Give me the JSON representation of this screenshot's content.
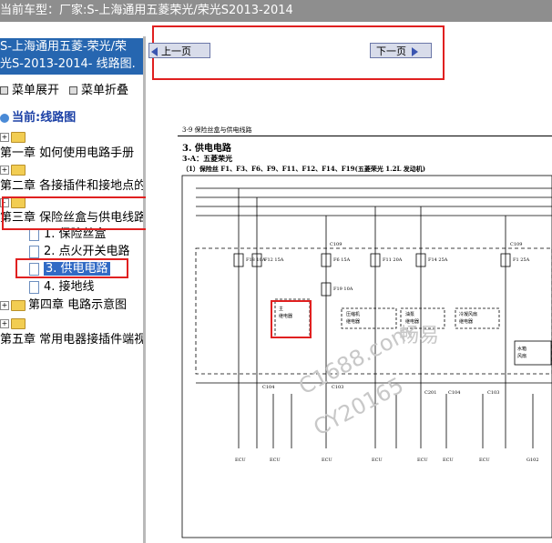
{
  "titlebar": {
    "label": "当前车型：",
    "model": "厂家:S-上海通用五菱荣光/荣光S2013-2014"
  },
  "sidebar": {
    "header_line1": "S-上海通用五菱-荣光/荣",
    "header_line2": "光S-2013-2014- 线路图.",
    "expand_label": "菜单展开",
    "collapse_label": "菜单折叠",
    "current_label": "当前:线路图",
    "tree": [
      {
        "label": "第一章 如何使用电路手册"
      },
      {
        "label": "第二章 各接插件和接地点的"
      },
      {
        "label": "第三章 保险丝盒与供电线路"
      },
      {
        "label": "1. 保险丝盒"
      },
      {
        "label": "2. 点火开关电路"
      },
      {
        "label": "3. 供电电路"
      },
      {
        "label": "4. 接地线"
      },
      {
        "label": "第四章 电路示意图"
      },
      {
        "label": "第五章 常用电器接插件端视"
      }
    ]
  },
  "nav": {
    "prev_label": "上一页",
    "next_label": "下一页"
  },
  "document": {
    "page_header": "3-9  保险丝盒与供电线路",
    "section_title": "3. 供电电路",
    "subsection": "3-A：五菱荣光",
    "subtitle": "（1）保险丝 F1、F3、F6、F9、F11、F12、F14、F19(五菱荣光 1.2L 发动机)",
    "fuses": [
      "F18\n10A",
      "F12\n15A",
      "F6\n15A",
      "F11\n20A",
      "F14\n25A",
      "F1\n25A"
    ],
    "fuse_extra": "F19\n10A",
    "connectors": [
      "C109",
      "C109",
      "C103",
      "C201",
      "C104",
      "C103",
      "C104"
    ],
    "relays": [
      "主\n继电器",
      "压缩机\n继电器",
      "油泵\n继电器",
      "冷凝\n风扇\n继电器",
      "水箱\n风扇"
    ],
    "bottom_labels": [
      "ECU",
      "ECU",
      "ECU",
      "ECU",
      "ECU",
      "ECU",
      "ECU",
      "G102"
    ],
    "watermark1": "畅易",
    "watermark2": "C1688.com",
    "watermark3": "CY20165"
  }
}
